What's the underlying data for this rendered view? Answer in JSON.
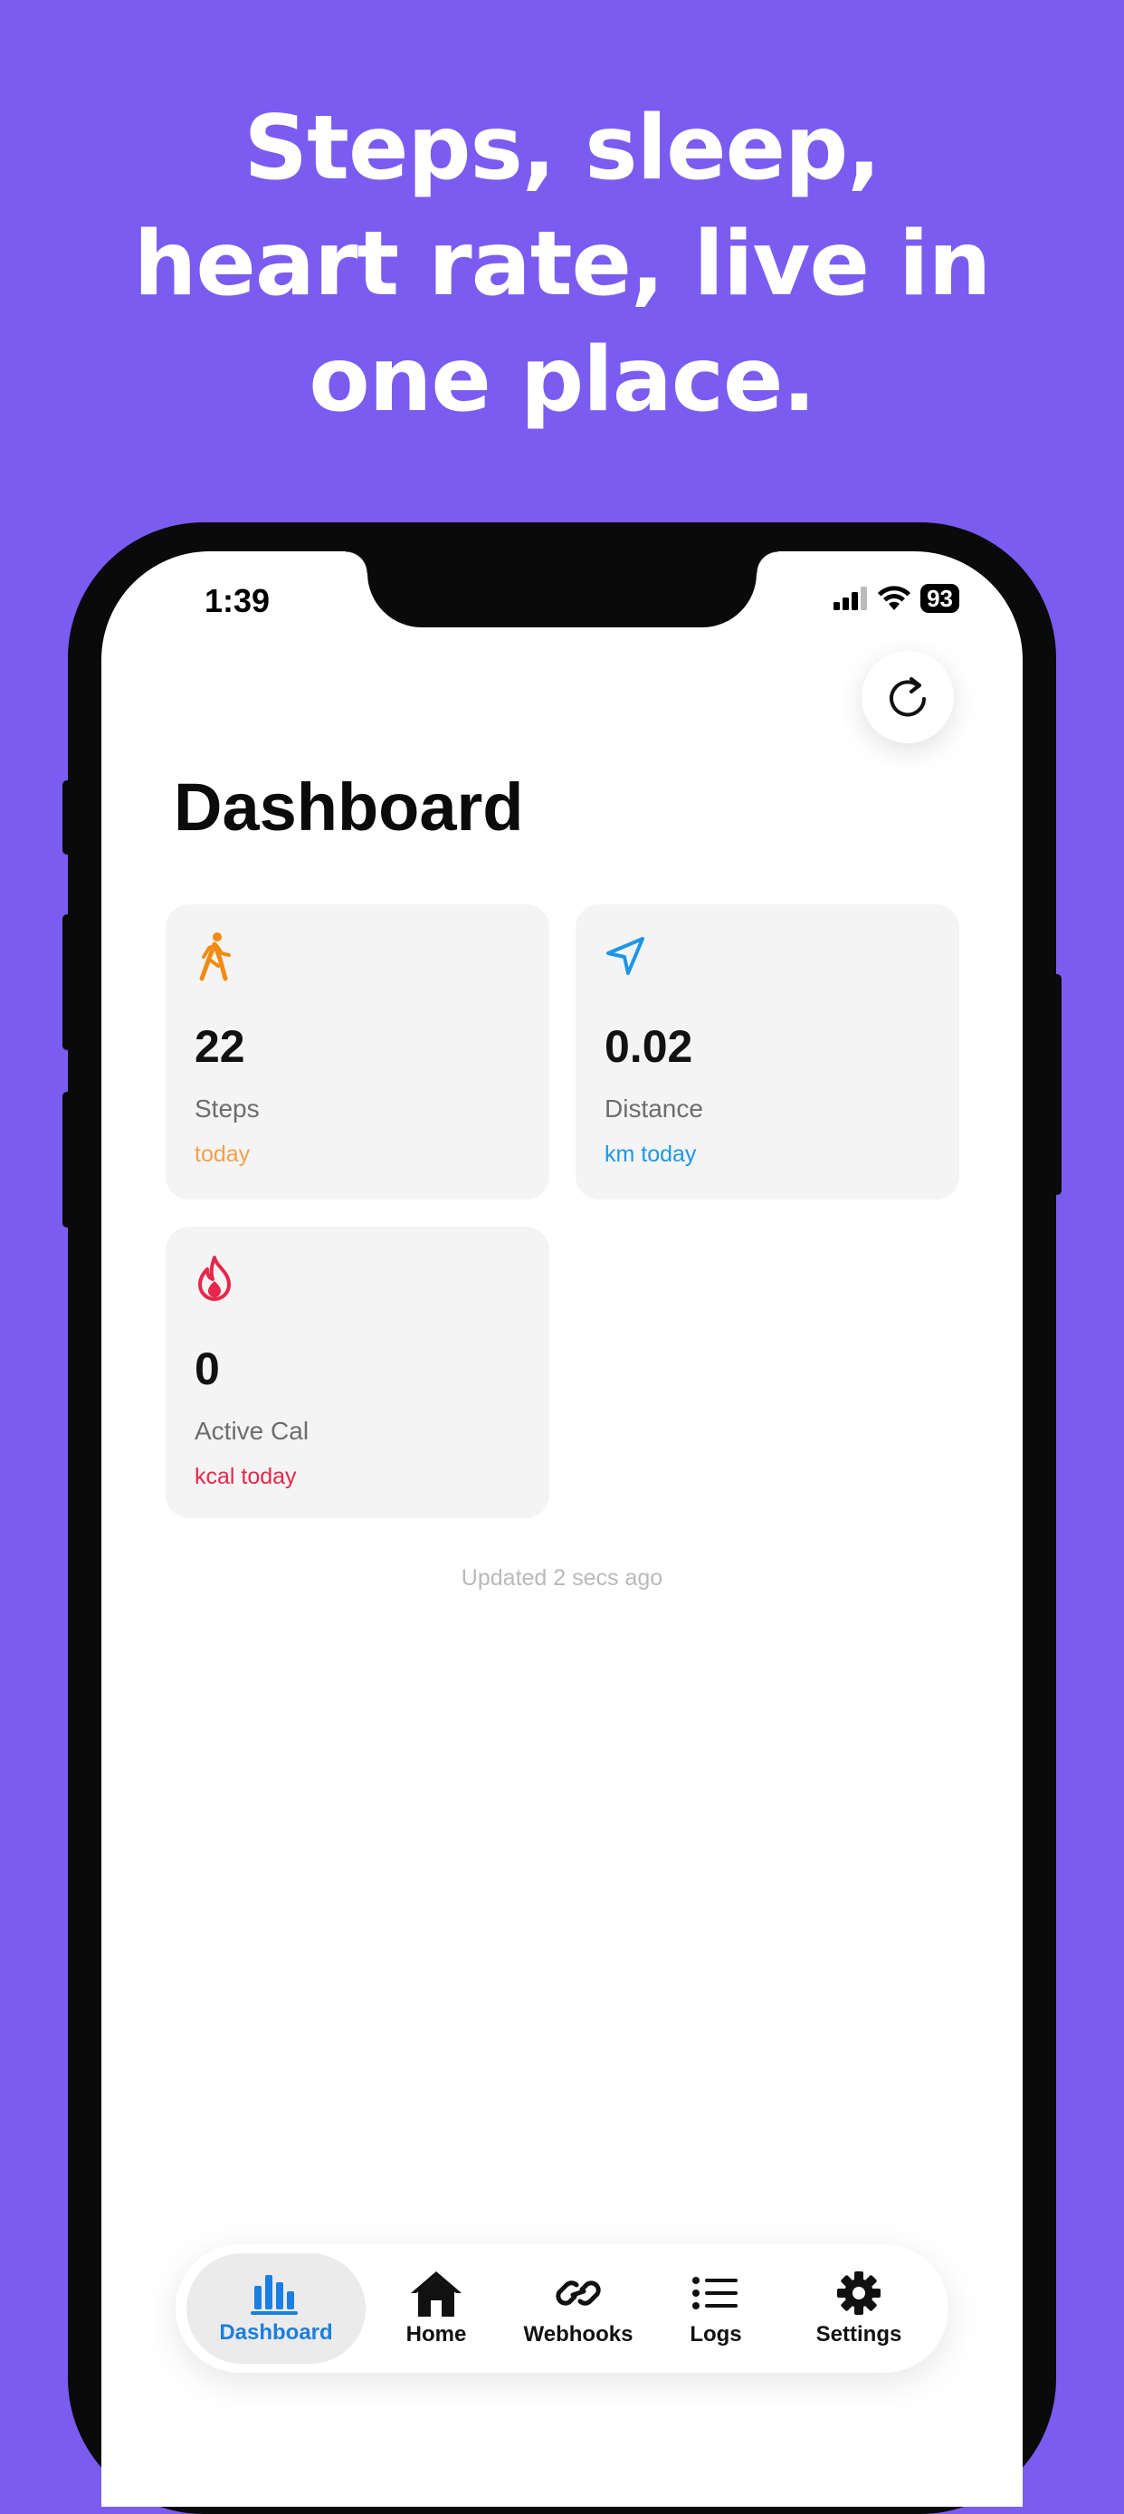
{
  "headline": {
    "line1": "Steps, sleep,",
    "line2": "heart rate, live in",
    "line3": "one place."
  },
  "status_bar": {
    "time": "1:39",
    "battery": "93"
  },
  "page": {
    "title": "Dashboard",
    "updated": "Updated 2 secs ago"
  },
  "cards": [
    {
      "value": "22",
      "label": "Steps",
      "sub": "today",
      "icon": "walking-icon",
      "color": "#F28B14"
    },
    {
      "value": "0.02",
      "label": "Distance",
      "sub": "km today",
      "icon": "location-arrow-icon",
      "color": "#1E96E6"
    },
    {
      "value": "0",
      "label": "Active Cal",
      "sub": "kcal today",
      "icon": "flame-icon",
      "color": "#E8264B"
    }
  ],
  "tabs": [
    {
      "label": "Dashboard",
      "icon": "chart-bars-icon",
      "active": true
    },
    {
      "label": "Home",
      "icon": "house-icon",
      "active": false
    },
    {
      "label": "Webhooks",
      "icon": "link-icon",
      "active": false
    },
    {
      "label": "Logs",
      "icon": "list-icon",
      "active": false
    },
    {
      "label": "Settings",
      "icon": "gear-icon",
      "active": false
    }
  ],
  "colors": {
    "background": "#7B5CF0",
    "accent": "#1A7FE0"
  }
}
